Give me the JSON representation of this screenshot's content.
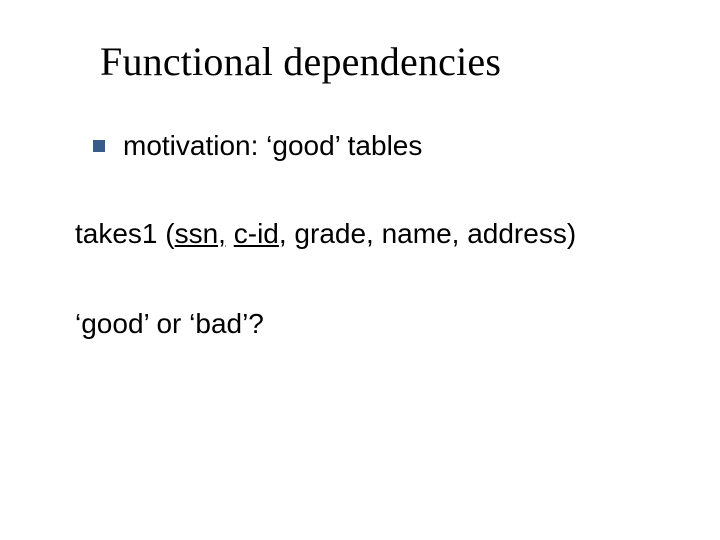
{
  "slide": {
    "title": "Functional dependencies",
    "bullet": {
      "text": "motivation: ‘good’ tables"
    },
    "line1": {
      "prefix": "takes1 (",
      "ssn": "ssn,",
      "space1": " ",
      "cid": "c-id",
      "rest": ", grade, name, address)"
    },
    "line2": "‘good’ or ‘bad’?"
  }
}
